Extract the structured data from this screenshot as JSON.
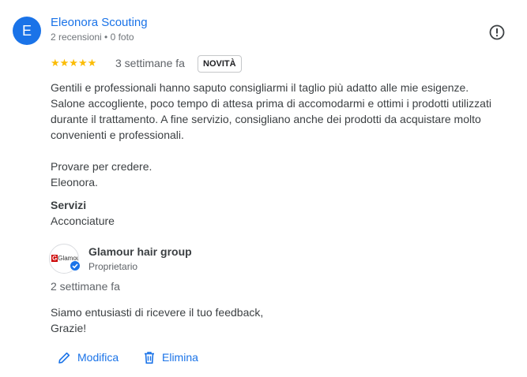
{
  "review": {
    "author_initial": "E",
    "author_name": "Eleonora Scouting",
    "author_meta": "2 recensioni • 0 foto",
    "stars": "★★★★★",
    "rating": 5,
    "date": "3 settimane fa",
    "badge": "NOVITÀ",
    "text_lines": [
      "Gentili e professionali hanno saputo consigliarmi il taglio più adatto alle mie esigenze.",
      "Salone accogliente, poco tempo di attesa prima di accomodarmi e ottimi i prodotti utilizzati",
      "durante il trattamento. A fine servizio, consigliano anche dei prodotti da acquistare molto",
      "convenienti e professionali.",
      "",
      "Provare per credere.",
      "Eleonora."
    ],
    "services_heading": "Servizi",
    "services_value": "Acconciature"
  },
  "owner_reply": {
    "logo_text": "Glamour",
    "name": "Glamour hair group",
    "role": "Proprietario",
    "date": "2 settimane fa",
    "text_lines": [
      "Siamo entusiasti di ricevere il tuo feedback,",
      "Grazie!"
    ]
  },
  "actions": {
    "edit_label": "Modifica",
    "delete_label": "Elimina"
  },
  "icons": {
    "report": "report-icon",
    "edit": "pencil-icon",
    "delete": "trash-icon",
    "verified": "verified-badge-icon"
  },
  "colors": {
    "accent": "#1a73e8",
    "star": "#fbbc04",
    "text": "#3c4043",
    "muted": "#5f6368"
  }
}
